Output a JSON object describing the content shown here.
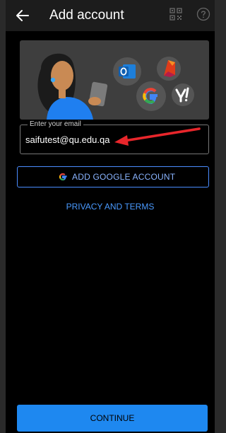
{
  "header": {
    "title": "Add account"
  },
  "email": {
    "label": "Enter your email",
    "value": "saifutest@qu.edu.qa"
  },
  "google_button": {
    "label": "ADD GOOGLE ACCOUNT"
  },
  "privacy_link": {
    "label": "PRIVACY AND TERMS"
  },
  "continue_button": {
    "label": "CONTINUE"
  },
  "colors": {
    "accent": "#1e88f0",
    "link": "#4a9aff",
    "annotation_arrow": "#e8262b"
  },
  "hero": {
    "icons": [
      "outlook-icon",
      "office-icon",
      "google-icon",
      "yahoo-icon"
    ]
  }
}
